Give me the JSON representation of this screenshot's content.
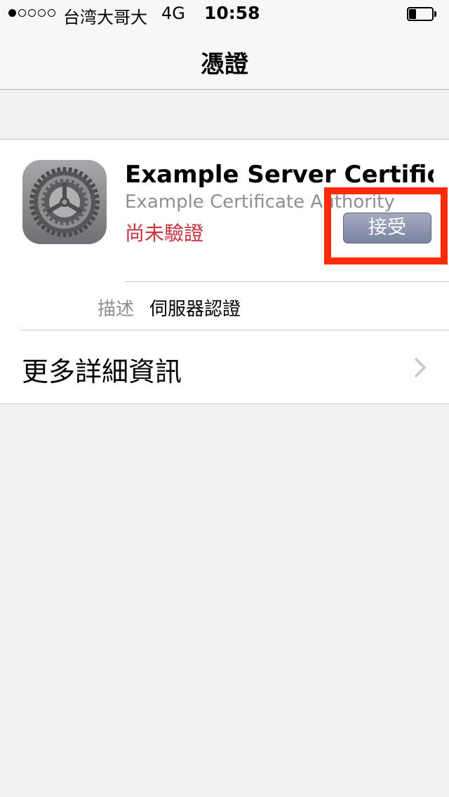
{
  "status_bar": {
    "carrier": "台湾大哥大",
    "network": "4G",
    "time": "10:58",
    "signal_bars_filled": 1,
    "signal_bars_total": 5,
    "battery_level": 0.3
  },
  "navbar": {
    "title": "憑證"
  },
  "certificate": {
    "icon": "settings-gear-icon",
    "title": "Example Server Certific...",
    "issuer": "Example Certificate Authority",
    "status": "尚未驗證",
    "accept_label": "接受"
  },
  "details": {
    "description_label": "描述",
    "description_value": "伺服器認證"
  },
  "more_info": {
    "label": "更多詳細資訊",
    "icon": "chevron-right-icon"
  },
  "colors": {
    "status_red": "#c7323a",
    "highlight_red": "#ff2a0a",
    "accept_button": "#8e95b0",
    "background": "#efeff4"
  }
}
